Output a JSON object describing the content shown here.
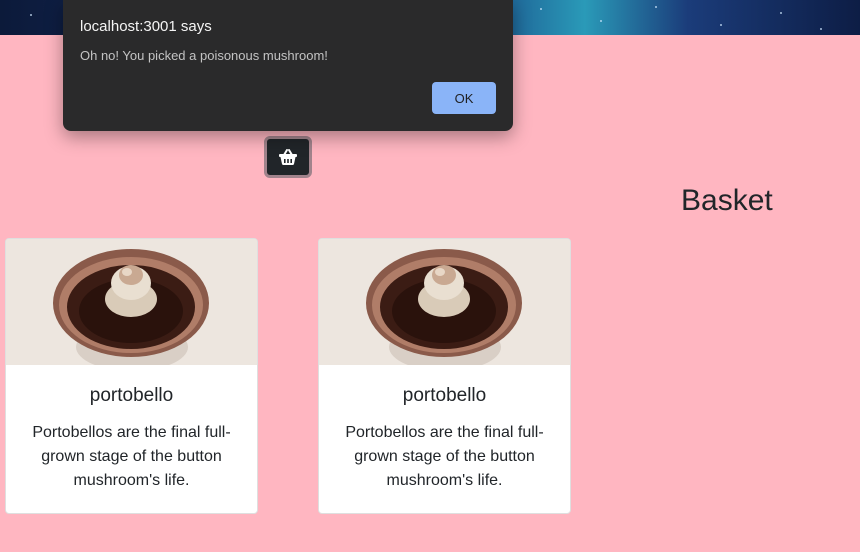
{
  "dialog": {
    "title": "localhost:3001 says",
    "message": "Oh no! You picked a poisonous mushroom!",
    "ok_label": "OK"
  },
  "basket": {
    "button_icon": "basket-icon",
    "heading": "Basket"
  },
  "cards": [
    {
      "title": "portobello",
      "description": "Portobellos are the final full-grown stage of the button mushroom's life.",
      "image": "portobello-mushroom-image"
    },
    {
      "title": "portobello",
      "description": "Portobellos are the final full-grown stage of the button mushroom's life.",
      "image": "portobello-mushroom-image"
    }
  ],
  "colors": {
    "page_background": "#ffb6c1",
    "dialog_background": "#2a2a2b",
    "ok_button": "#8ab4f8",
    "basket_button": "#212529"
  }
}
